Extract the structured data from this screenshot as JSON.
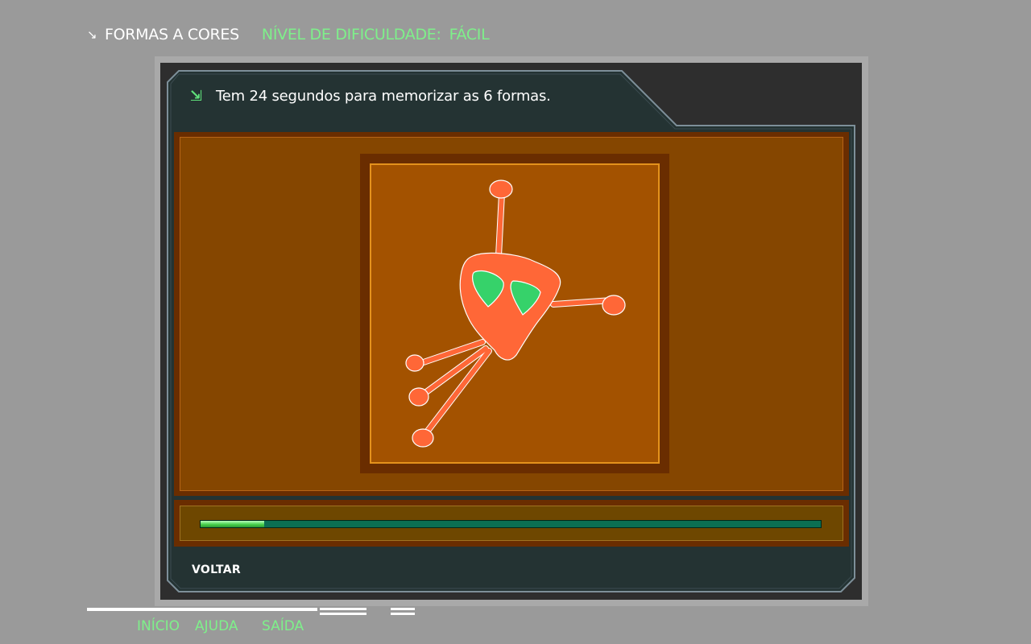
{
  "header": {
    "arrow_icon": "↘",
    "title": "FORMAS A CORES",
    "difficulty_label": "NÍVEL DE DIFICULDADE:",
    "difficulty_value": "FÁCIL"
  },
  "message": {
    "icon": "double-arrow-icon",
    "text": "Tem 24 segundos para memorizar as 6 formas."
  },
  "timer": {
    "progress": 0.103
  },
  "back_label": "VOLTAR",
  "footer_nav": {
    "home": "INÍCIO",
    "help": "AJUDA",
    "exit": "SAÍDA"
  },
  "colors": {
    "accent": "#7ef08a",
    "shape_body": "#ff6737",
    "shape_spots": "#36d26a",
    "card": "#a35200",
    "panel": "#243333"
  }
}
